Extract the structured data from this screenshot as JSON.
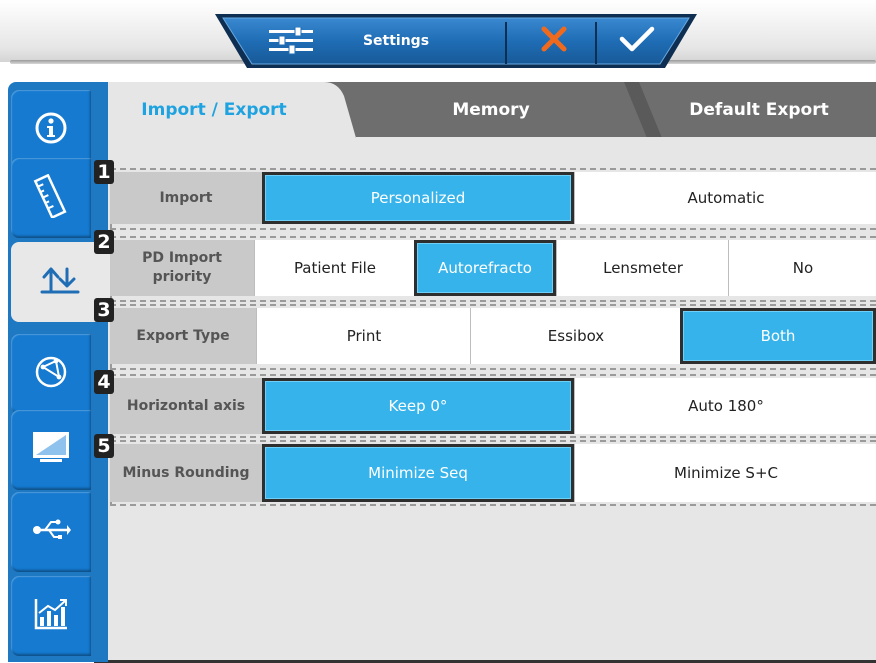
{
  "toolbar": {
    "settings_label": "Settings",
    "settings_icon": "sliders-icon",
    "cancel_icon": "close-icon",
    "confirm_icon": "check-icon",
    "accent": "#1f6db5",
    "cancel_color": "#f06a1e"
  },
  "sidebar": {
    "items": [
      {
        "name": "info",
        "icon": "info-icon"
      },
      {
        "name": "ruler",
        "icon": "ruler-icon"
      },
      {
        "name": "import-export",
        "icon": "import-export-icon",
        "active": true
      },
      {
        "name": "network",
        "icon": "network-icon"
      },
      {
        "name": "display",
        "icon": "monitor-icon"
      },
      {
        "name": "usb",
        "icon": "usb-icon"
      },
      {
        "name": "statistics",
        "icon": "chart-icon"
      }
    ]
  },
  "tabs": [
    {
      "label": "Import / Export",
      "active": true
    },
    {
      "label": "Memory",
      "active": false
    },
    {
      "label": "Default Export",
      "active": false
    }
  ],
  "rows": [
    {
      "number": "1",
      "label": "Import",
      "options": [
        "Personalized",
        "Automatic"
      ],
      "selected": "Personalized"
    },
    {
      "number": "2",
      "label": "PD Import priority",
      "options": [
        "Patient File",
        "Autorefracto",
        "Lensmeter",
        "No"
      ],
      "selected": "Autorefracto"
    },
    {
      "number": "3",
      "label": "Export Type",
      "options": [
        "Print",
        "Essibox",
        "Both"
      ],
      "selected": "Both"
    },
    {
      "number": "4",
      "label": "Horizontal axis",
      "options": [
        "Keep 0°",
        "Auto 180°"
      ],
      "selected": "Keep 0°"
    },
    {
      "number": "5",
      "label": "Minus Rounding",
      "options": [
        "Minimize Seq",
        "Minimize S+C"
      ],
      "selected": "Minimize Seq"
    }
  ],
  "colors": {
    "selected": "#36b3ea",
    "sidebar": "#1e78c2",
    "active_tab_text": "#1fa3e0",
    "inactive_tab": "#6e6e6e"
  }
}
